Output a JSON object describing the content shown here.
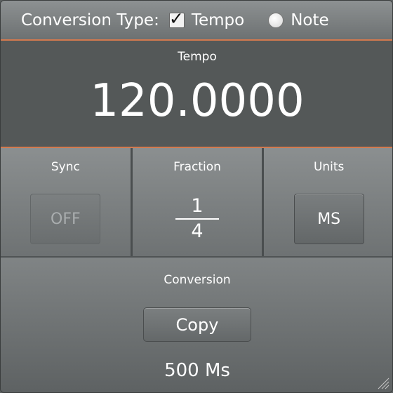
{
  "topbar": {
    "label": "Conversion Type:",
    "option_tempo": "Tempo",
    "option_note": "Note",
    "check_glyph": "✓"
  },
  "tempo": {
    "title": "Tempo",
    "value": "120.0000"
  },
  "columns": {
    "sync": {
      "title": "Sync",
      "button": "OFF"
    },
    "fraction": {
      "title": "Fraction",
      "numerator": "1",
      "denominator": "4"
    },
    "units": {
      "title": "Units",
      "button": "MS"
    }
  },
  "conversion": {
    "title": "Conversion",
    "copy_label": "Copy",
    "result": "500 Ms"
  },
  "colors": {
    "accent": "#d37a4f",
    "panel": "#545858"
  }
}
